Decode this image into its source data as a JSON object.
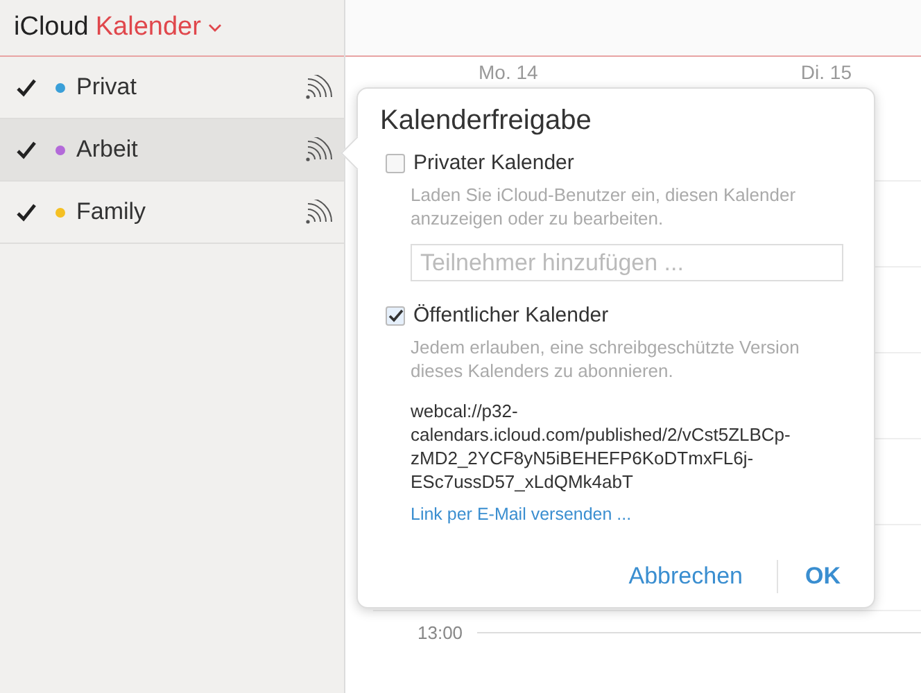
{
  "app_title": {
    "brand": "iCloud",
    "name": "Kalender"
  },
  "calendars": [
    {
      "name": "Privat",
      "checked": true,
      "selected": false,
      "color": "#3a9fd8"
    },
    {
      "name": "Arbeit",
      "checked": true,
      "selected": true,
      "color": "#b36ad9"
    },
    {
      "name": "Family",
      "checked": true,
      "selected": false,
      "color": "#f5c023"
    }
  ],
  "day_headers": [
    "Mo. 14",
    "Di. 15"
  ],
  "time_label": "13:00",
  "sharing_popover": {
    "title": "Kalenderfreigabe",
    "private": {
      "label": "Privater Kalender",
      "checked": false,
      "description": "Laden Sie iCloud-Benutzer ein, diesen Kalender anzuzeigen oder zu bearbeiten.",
      "placeholder": "Teilnehmer hinzufügen ..."
    },
    "public": {
      "label": "Öffentlicher Kalender",
      "checked": true,
      "description": "Jedem erlauben, eine schreibgeschützte Version dieses Kalenders zu abonnieren.",
      "url": "webcal://p32-calendars.icloud.com/published/2/vCst5ZLBCp-zMD2_2YCF8yN5iBEHEFP6KoDTmxFL6j-ESc7ussD57_xLdQMk4abT",
      "email_link": "Link per E-Mail versenden ..."
    },
    "buttons": [
      {
        "label": "Abbrechen",
        "kind": "cancel"
      },
      {
        "label": "OK",
        "kind": "default"
      }
    ]
  }
}
